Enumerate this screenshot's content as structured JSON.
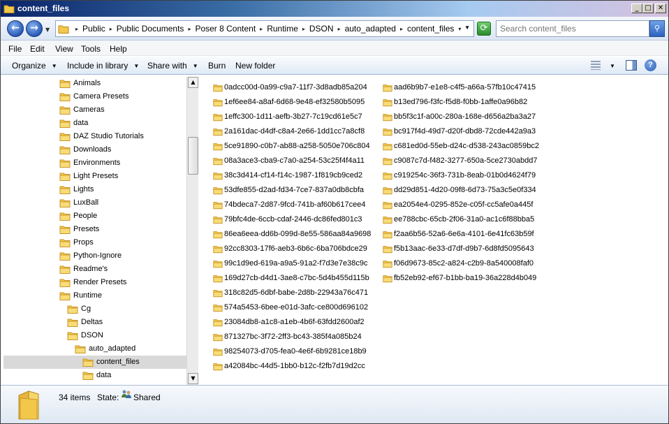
{
  "window": {
    "title": "content_files"
  },
  "address": {
    "crumbs": [
      "Public",
      "Public Documents",
      "Poser 8 Content",
      "Runtime",
      "DSON",
      "auto_adapted",
      "content_files"
    ]
  },
  "search": {
    "placeholder": "Search content_files"
  },
  "menu": [
    "File",
    "Edit",
    "View",
    "Tools",
    "Help"
  ],
  "toolbar": {
    "organize": "Organize",
    "include": "Include in library",
    "share": "Share with",
    "burn": "Burn",
    "new_folder": "New folder"
  },
  "nav_tree": [
    {
      "label": "Animals",
      "level": 0
    },
    {
      "label": "Camera Presets",
      "level": 0
    },
    {
      "label": "Cameras",
      "level": 0
    },
    {
      "label": "data",
      "level": 0
    },
    {
      "label": "DAZ Studio Tutorials",
      "level": 0
    },
    {
      "label": "Downloads",
      "level": 0
    },
    {
      "label": "Environments",
      "level": 0
    },
    {
      "label": "Light Presets",
      "level": 0
    },
    {
      "label": "Lights",
      "level": 0
    },
    {
      "label": "LuxBall",
      "level": 0
    },
    {
      "label": "People",
      "level": 0
    },
    {
      "label": "Presets",
      "level": 0
    },
    {
      "label": "Props",
      "level": 0
    },
    {
      "label": "Python-Ignore",
      "level": 0
    },
    {
      "label": "Readme's",
      "level": 0
    },
    {
      "label": "Render Presets",
      "level": 0
    },
    {
      "label": "Runtime",
      "level": 0
    },
    {
      "label": "Cg",
      "level": 1
    },
    {
      "label": "Deltas",
      "level": 1
    },
    {
      "label": "DSON",
      "level": 1
    },
    {
      "label": "auto_adapted",
      "level": 2
    },
    {
      "label": "content_files",
      "level": 3,
      "selected": true
    },
    {
      "label": "data",
      "level": 3
    }
  ],
  "files_col1": [
    "0adcc00d-0a99-c9a7-11f7-3d8adb85a204",
    "1ef6ee84-a8af-6d68-9e48-ef32580b5095",
    "1effc300-1d11-aefb-3b27-7c19cd61e5c7",
    "2a161dac-d4df-c8a4-2e66-1dd1cc7a8cf8",
    "5ce91890-c0b7-ab88-a258-5050e706c804",
    "08a3ace3-cba9-c7a0-a254-53c25f4f4a11",
    "38c3d414-cf14-f14c-1987-1f819cb9ced2",
    "53dfe855-d2ad-fd34-7ce7-837a0db8cbfa",
    "74bdeca7-2d87-9fcd-741b-af60b617cee4",
    "79bfc4de-6ccb-cdaf-2446-dc86fed801c3",
    "86ea6eea-dd6b-099d-8e55-586aa84a9698",
    "92cc8303-17f6-aeb3-6b6c-6ba706bdce29",
    "99c1d9ed-619a-a9a5-91a2-f7d3e7e38c9c",
    "169d27cb-d4d1-3ae8-c7bc-5d4b455d115b",
    "318c82d5-6dbf-babe-2d8b-22943a76c471",
    "574a5453-6bee-e01d-3afc-ce800d696102",
    "23084db8-a1c8-a1eb-4b6f-63fdd2600af2",
    "871327bc-3f72-2ff3-bc43-385f4a085b24",
    "98254073-d705-fea0-4e6f-6b9281ce18b9",
    "a42084bc-44d5-1bb0-b12c-f2fb7d19d2cc"
  ],
  "files_col2": [
    "aad6b9b7-e1e8-c4f5-a66a-57fb10c47415",
    "b13ed796-f3fc-f5d8-f0bb-1affe0a96b82",
    "bb5f3c1f-a00c-280a-168e-d656a2ba3a27",
    "bc917f4d-49d7-d20f-dbd8-72cde442a9a3",
    "c681ed0d-55eb-d24c-d538-243ac0859bc2",
    "c9087c7d-f482-3277-650a-5ce2730abdd7",
    "c919254c-36f3-731b-8eab-01b0d4624f79",
    "dd29d851-4d20-09f8-6d73-75a3c5e0f334",
    "ea2054e4-0295-852e-c05f-cc5afe0a445f",
    "ee788cbc-65cb-2f06-31a0-ac1c6f88bba5",
    "f2aa6b56-52a6-6e6a-4101-6e41fc63b59f",
    "f5b13aac-6e33-d7df-d9b7-6d8fd5095643",
    "f06d9673-85c2-a824-c2b9-8a540008faf0",
    "fb52eb92-ef67-b1bb-ba19-36a228d4b049"
  ],
  "details": {
    "count": "34 items",
    "state_label": "State:",
    "state_value": "Shared"
  },
  "colors": {
    "folder": "#f3c84a",
    "folder_dark": "#c9962a",
    "selection": "#d9d9d9"
  }
}
